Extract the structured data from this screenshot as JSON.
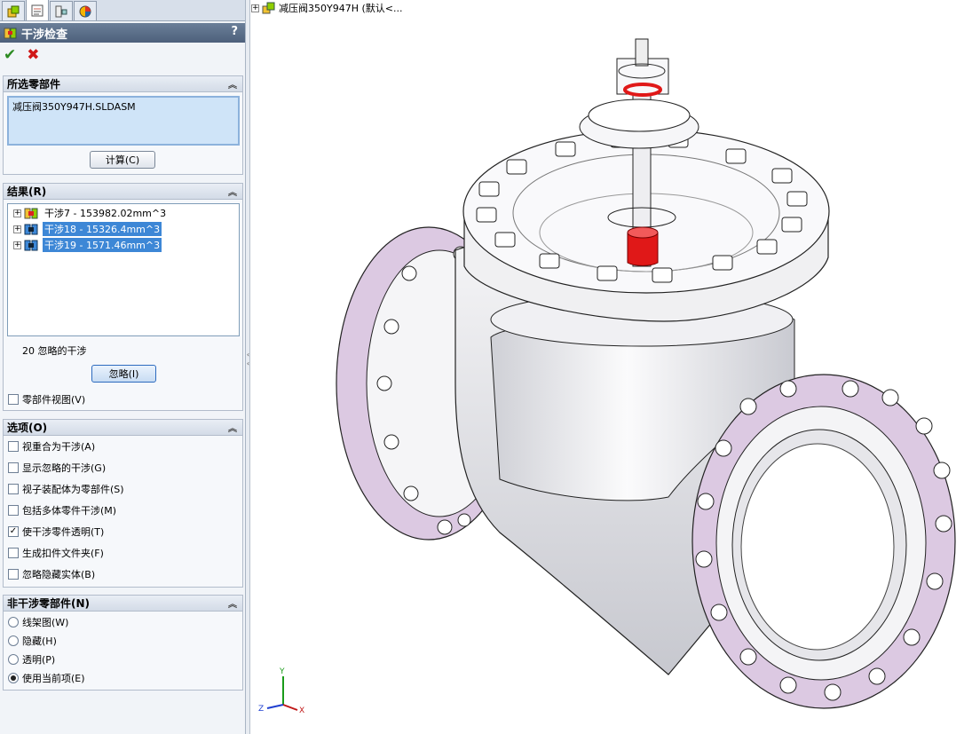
{
  "panel": {
    "title": "干涉检查",
    "help": "?",
    "selected_components": {
      "header": "所选零部件",
      "items": [
        "减压阀350Y947H.SLDASM"
      ],
      "calc_button": "计算(C)"
    },
    "results": {
      "header": "结果(R)",
      "items": [
        {
          "label": "干涉7 - 153982.02mm^3",
          "selected": false
        },
        {
          "label": "干涉18 - 15326.4mm^3",
          "selected": true
        },
        {
          "label": "干涉19 - 1571.46mm^3",
          "selected": true
        }
      ],
      "ignored_count": "20 忽略的干涉",
      "ignore_button": "忽略(I)",
      "component_view": "零部件视图(V)"
    },
    "options": {
      "header": "选项(O)",
      "items": [
        {
          "label": "视重合为干涉(A)",
          "checked": false
        },
        {
          "label": "显示忽略的干涉(G)",
          "checked": false
        },
        {
          "label": "视子装配体为零部件(S)",
          "checked": false
        },
        {
          "label": "包括多体零件干涉(M)",
          "checked": false
        },
        {
          "label": "使干涉零件透明(T)",
          "checked": true
        },
        {
          "label": "生成扣件文件夹(F)",
          "checked": false
        },
        {
          "label": "忽略隐藏实体(B)",
          "checked": false
        }
      ]
    },
    "non_interfering": {
      "header": "非干涉零部件(N)",
      "items": [
        {
          "label": "线架图(W)",
          "selected": false
        },
        {
          "label": "隐藏(H)",
          "selected": false
        },
        {
          "label": "透明(P)",
          "selected": false
        },
        {
          "label": "使用当前项(E)",
          "selected": true
        }
      ]
    }
  },
  "viewport": {
    "tree_title": "减压阀350Y947H  (默认<...",
    "triad": {
      "x": "X",
      "y": "Y",
      "z": "Z"
    }
  },
  "colors": {
    "title_bar": "#56698a",
    "selection": "#3d87d6",
    "interference": "#e01818",
    "flange_face": "#dcc9e2"
  }
}
